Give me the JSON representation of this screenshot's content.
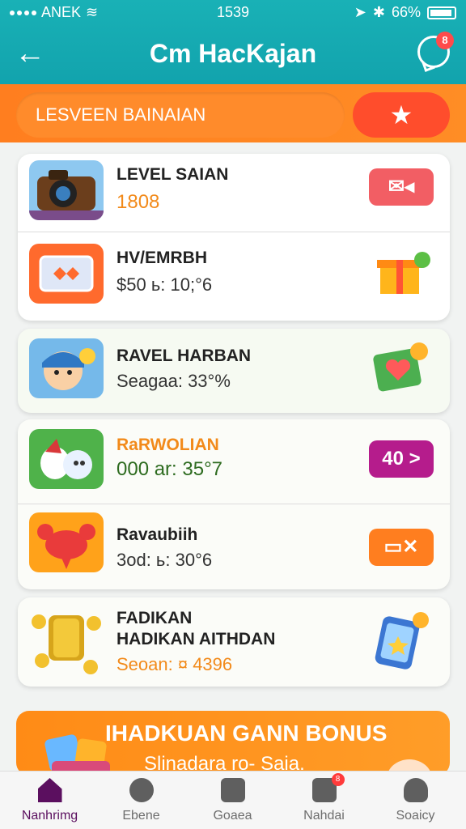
{
  "status_bar": {
    "carrier": "ANEK",
    "time": "1539",
    "battery": "66%"
  },
  "header": {
    "title": "Cm HacKajan",
    "chat_badge": "8"
  },
  "filter_bar": {
    "pill_label": "LESVEEN BAINAIAN"
  },
  "cards": [
    {
      "rows": [
        {
          "name": "LEVEL SAIAN",
          "value": "1808",
          "value_color": "#f28a1a",
          "action_color": "#f25e64"
        },
        {
          "name": "HV/EMRBH",
          "value": "$50 ь: 10;°6",
          "value_color": "#333",
          "action_color": ""
        }
      ]
    },
    {
      "rows": [
        {
          "name": "RAVEL HARBAN",
          "value": "Seagaa: 33°%",
          "value_color": "#333",
          "action_color": ""
        }
      ]
    },
    {
      "rows": [
        {
          "name": "RaRWOLIAN",
          "value": "000 ar: 35°7",
          "value_color": "#2d6b1f",
          "action_color": "#b51c8c",
          "action_text": "40 >"
        },
        {
          "name": "Ravaubiih",
          "value": "3od: ь: 30°6",
          "value_color": "#333",
          "action_color": "#ff7e1f"
        }
      ]
    },
    {
      "rows": [
        {
          "name": "FADIKAN",
          "name2": "HADIKAN AITHDAN",
          "value": "Seoan: ¤ 4396",
          "value_color": "#f28a1a",
          "action_color": ""
        }
      ]
    }
  ],
  "bonus": {
    "title": "IHADKUAN GANN BONUS",
    "subtitle": "Slinadara ro- Saia."
  },
  "bottom_nav": [
    {
      "label": "Nanhrimg",
      "icon": "home-icon",
      "active": true
    },
    {
      "label": "Ebene",
      "icon": "gear-icon",
      "active": false
    },
    {
      "label": "Goaea",
      "icon": "calculator-icon",
      "active": false
    },
    {
      "label": "Nahdai",
      "icon": "people-icon",
      "active": false,
      "badge": "8"
    },
    {
      "label": "Soaicy",
      "icon": "person-icon",
      "active": false
    }
  ]
}
